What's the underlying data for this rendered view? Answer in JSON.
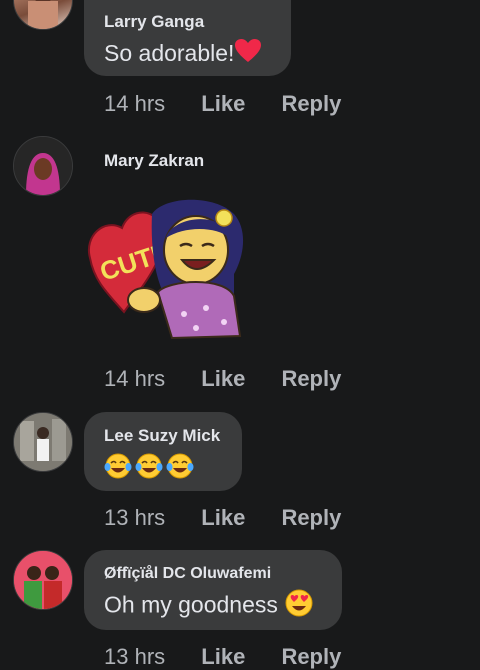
{
  "comments": [
    {
      "author": "Larry Ganga",
      "text": "So adorable!",
      "emoji": "heart-emoji",
      "time": "14 hrs",
      "like": "Like",
      "reply": "Reply"
    },
    {
      "author": "Mary Zakran",
      "sticker_text": "CUTE",
      "time": "14 hrs",
      "like": "Like",
      "reply": "Reply"
    },
    {
      "author": "Lee Suzy Mick",
      "emoji": "tears-of-joy-emoji",
      "time": "13 hrs",
      "like": "Like",
      "reply": "Reply"
    },
    {
      "author": "Øffïçïål DC Oluwafemi",
      "text": "Oh my goodness",
      "emoji": "heart-eyes-emoji",
      "time": "13 hrs",
      "like": "Like",
      "reply": "Reply"
    }
  ],
  "colors": {
    "background": "#18191a",
    "bubble": "#3a3b3c",
    "text": "#e4e6eb",
    "secondary": "#b0b3b8",
    "heart": "#f02849"
  }
}
